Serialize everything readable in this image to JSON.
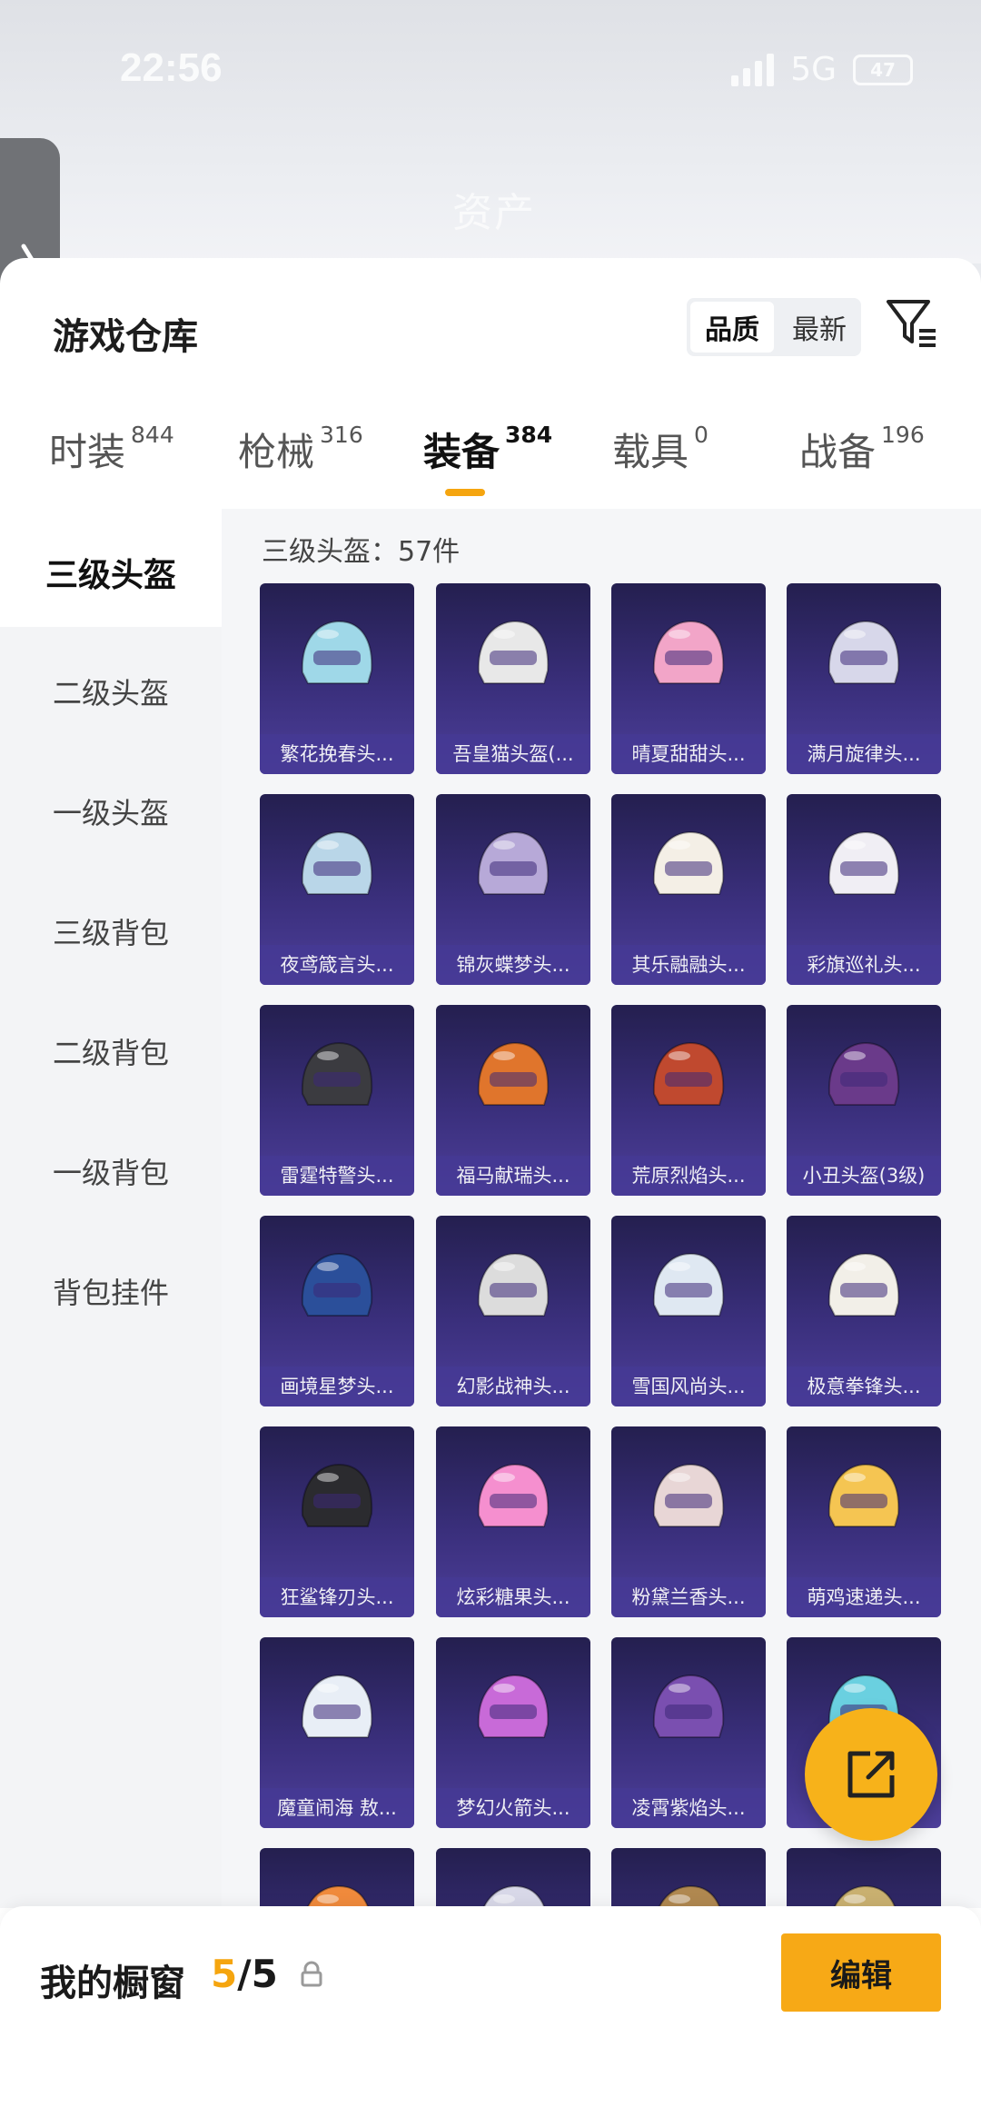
{
  "status_bar": {
    "time": "22:56",
    "network": "5G",
    "battery": "47"
  },
  "blurred_title": "资产",
  "header": {
    "title": "游戏仓库",
    "sort_options": [
      "品质",
      "最新"
    ],
    "active_sort": "品质"
  },
  "tabs": [
    {
      "label": "时装",
      "count": "844"
    },
    {
      "label": "枪械",
      "count": "316"
    },
    {
      "label": "装备",
      "count": "384"
    },
    {
      "label": "载具",
      "count": "0"
    },
    {
      "label": "战备",
      "count": "196"
    }
  ],
  "active_tab": "装备",
  "categories": [
    "三级头盔",
    "二级头盔",
    "一级头盔",
    "三级背包",
    "二级背包",
    "一级背包",
    "背包挂件"
  ],
  "active_category": "三级头盔",
  "grid_header": "三级头盔：57件",
  "items": [
    "繁花挽春头...",
    "吾皇猫头盔(...",
    "晴夏甜甜头...",
    "满月旋律头...",
    "夜鸢箴言头...",
    "锦灰蝶梦头...",
    "其乐融融头...",
    "彩旗巡礼头...",
    "雷霆特警头...",
    "福马献瑞头...",
    "荒原烈焰头...",
    "小丑头盔(3级)",
    "画境星梦头...",
    "幻影战神头...",
    "雪国风尚头...",
    "极意拳锋头...",
    "狂鲨锋刃头...",
    "炫彩糖果头...",
    "粉黛兰香头...",
    "萌鸡速递头...",
    "魔童闹海 敖...",
    "梦幻火箭头...",
    "凌霄紫焰头...",
    "",
    "",
    "",
    "",
    ""
  ],
  "item_colors": [
    "#9fd8e8",
    "#e8e8e8",
    "#f2a5c8",
    "#d7d7ea",
    "#b9d6e8",
    "#b7a9d8",
    "#f4efe6",
    "#f0eef4",
    "#3b3b40",
    "#e0752c",
    "#c0492f",
    "#6a3a8a",
    "#2b4f9a",
    "#dcdcdc",
    "#dfe8f2",
    "#f2efe8",
    "#2b2b2f",
    "#f58fcf",
    "#e8d6d6",
    "#f5c552",
    "#e8eef6",
    "#c86ad8",
    "#7a4fb0",
    "#6ad0e0",
    "#f08a3c",
    "#d8d8e8",
    "#b08850",
    "#c9b070"
  ],
  "bottom_bar": {
    "title": "我的橱窗",
    "count_current": "5",
    "count_total": "/5",
    "edit_label": "编辑"
  }
}
